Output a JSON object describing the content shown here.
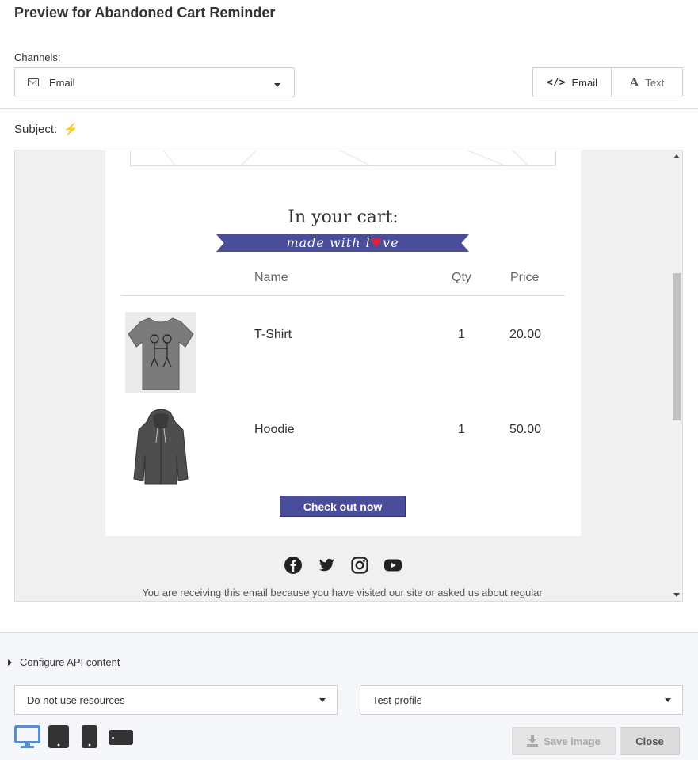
{
  "header": {
    "title": "Preview for Abandoned Cart Reminder",
    "channels_label": "Channels:",
    "channel_selected": "Email",
    "view_email_label": "Email",
    "view_text_label": "Text",
    "subject_label": "Subject:",
    "subject_value": "⚡"
  },
  "email": {
    "cart_heading": "In your cart:",
    "ribbon_prefix": "made with l",
    "ribbon_heart": "♥",
    "ribbon_suffix": "ve",
    "columns": {
      "name": "Name",
      "qty": "Qty",
      "price": "Price"
    },
    "items": [
      {
        "name": "T-Shirt",
        "qty": "1",
        "price": "20.00",
        "image_icon": "tshirt-icon"
      },
      {
        "name": "Hoodie",
        "qty": "1",
        "price": "50.00",
        "image_icon": "hoodie-icon"
      }
    ],
    "checkout_label": "Check out now",
    "social_icons": [
      "facebook-icon",
      "twitter-icon",
      "instagram-icon",
      "youtube-icon"
    ],
    "footer_text": "You are receiving this email because you have visited our site or asked us about regular"
  },
  "bottom": {
    "configure_label": "Configure API content",
    "resources_selected": "Do not use resources",
    "profile_selected": "Test profile",
    "save_label": "Save image",
    "close_label": "Close"
  },
  "colors": {
    "accent": "#4a4e9a",
    "device_active": "#5b8ec9",
    "heart": "#e0203a",
    "bolt": "#f5b800"
  }
}
